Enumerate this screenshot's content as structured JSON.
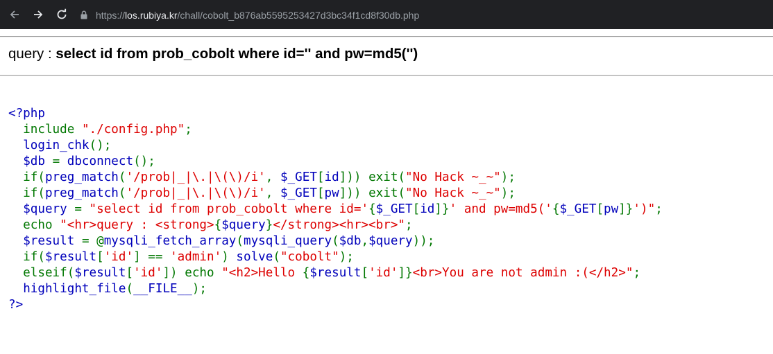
{
  "browser": {
    "url_scheme": "https://",
    "url_host": "los.rubiya.kr",
    "url_path": "/chall/cobolt_b876ab5595253427d3bc34f1cd8f30db.php",
    "back_icon": "arrow-left-icon",
    "forward_icon": "arrow-right-icon",
    "reload_icon": "reload-icon",
    "lock_icon": "lock-icon"
  },
  "page": {
    "query_label": "query : ",
    "query_text": "select id from prob_cobolt where id='' and pw=md5('')"
  },
  "colors": {
    "php_default": "#0000BB",
    "php_keyword": "#007700",
    "php_string": "#DD0000"
  },
  "source_code": [
    [
      [
        "d",
        "<?php"
      ]
    ],
    [
      [
        "k",
        "  include "
      ],
      [
        "s",
        "\"./config.php\""
      ],
      [
        "k",
        ";"
      ]
    ],
    [
      [
        "k",
        "  "
      ],
      [
        "d",
        "login_chk"
      ],
      [
        "k",
        "();"
      ]
    ],
    [
      [
        "k",
        "  "
      ],
      [
        "d",
        "$db "
      ],
      [
        "k",
        "= "
      ],
      [
        "d",
        "dbconnect"
      ],
      [
        "k",
        "();"
      ]
    ],
    [
      [
        "k",
        "  if("
      ],
      [
        "d",
        "preg_match"
      ],
      [
        "k",
        "("
      ],
      [
        "s",
        "'/prob|_|\\.|\\(\\)/i'"
      ],
      [
        "k",
        ", "
      ],
      [
        "d",
        "$_GET"
      ],
      [
        "k",
        "["
      ],
      [
        "d",
        "id"
      ],
      [
        "k",
        "])) exit("
      ],
      [
        "s",
        "\"No Hack ~_~\""
      ],
      [
        "k",
        ");"
      ]
    ],
    [
      [
        "k",
        "  if("
      ],
      [
        "d",
        "preg_match"
      ],
      [
        "k",
        "("
      ],
      [
        "s",
        "'/prob|_|\\.|\\(\\)/i'"
      ],
      [
        "k",
        ", "
      ],
      [
        "d",
        "$_GET"
      ],
      [
        "k",
        "["
      ],
      [
        "d",
        "pw"
      ],
      [
        "k",
        "])) exit("
      ],
      [
        "s",
        "\"No Hack ~_~\""
      ],
      [
        "k",
        ");"
      ]
    ],
    [
      [
        "k",
        "  "
      ],
      [
        "d",
        "$query "
      ],
      [
        "k",
        "= "
      ],
      [
        "s",
        "\"select id from prob_cobolt where id='"
      ],
      [
        "k",
        "{"
      ],
      [
        "d",
        "$_GET"
      ],
      [
        "k",
        "["
      ],
      [
        "d",
        "id"
      ],
      [
        "k",
        "]}"
      ],
      [
        "s",
        "' and pw=md5('"
      ],
      [
        "k",
        "{"
      ],
      [
        "d",
        "$_GET"
      ],
      [
        "k",
        "["
      ],
      [
        "d",
        "pw"
      ],
      [
        "k",
        "]}"
      ],
      [
        "s",
        "')\""
      ],
      [
        "k",
        ";"
      ]
    ],
    [
      [
        "k",
        "  echo "
      ],
      [
        "s",
        "\"<hr>query : <strong>"
      ],
      [
        "k",
        "{"
      ],
      [
        "d",
        "$query"
      ],
      [
        "k",
        "}"
      ],
      [
        "s",
        "</strong><hr><br>\""
      ],
      [
        "k",
        ";"
      ]
    ],
    [
      [
        "k",
        "  "
      ],
      [
        "d",
        "$result "
      ],
      [
        "k",
        "= @"
      ],
      [
        "d",
        "mysqli_fetch_array"
      ],
      [
        "k",
        "("
      ],
      [
        "d",
        "mysqli_query"
      ],
      [
        "k",
        "("
      ],
      [
        "d",
        "$db"
      ],
      [
        "k",
        ","
      ],
      [
        "d",
        "$query"
      ],
      [
        "k",
        "));"
      ]
    ],
    [
      [
        "k",
        "  if("
      ],
      [
        "d",
        "$result"
      ],
      [
        "k",
        "["
      ],
      [
        "s",
        "'id'"
      ],
      [
        "k",
        "] == "
      ],
      [
        "s",
        "'admin'"
      ],
      [
        "k",
        ") "
      ],
      [
        "d",
        "solve"
      ],
      [
        "k",
        "("
      ],
      [
        "s",
        "\"cobolt\""
      ],
      [
        "k",
        ");"
      ]
    ],
    [
      [
        "k",
        "  elseif("
      ],
      [
        "d",
        "$result"
      ],
      [
        "k",
        "["
      ],
      [
        "s",
        "'id'"
      ],
      [
        "k",
        "]) echo "
      ],
      [
        "s",
        "\"<h2>Hello "
      ],
      [
        "k",
        "{"
      ],
      [
        "d",
        "$result"
      ],
      [
        "k",
        "["
      ],
      [
        "s",
        "'id'"
      ],
      [
        "k",
        "]}"
      ],
      [
        "s",
        "<br>You are not admin :(</h2>\""
      ],
      [
        "k",
        ";"
      ]
    ],
    [
      [
        "k",
        "  "
      ],
      [
        "d",
        "highlight_file"
      ],
      [
        "k",
        "("
      ],
      [
        "d",
        "__FILE__"
      ],
      [
        "k",
        ");"
      ]
    ],
    [
      [
        "d",
        "?>"
      ]
    ]
  ]
}
